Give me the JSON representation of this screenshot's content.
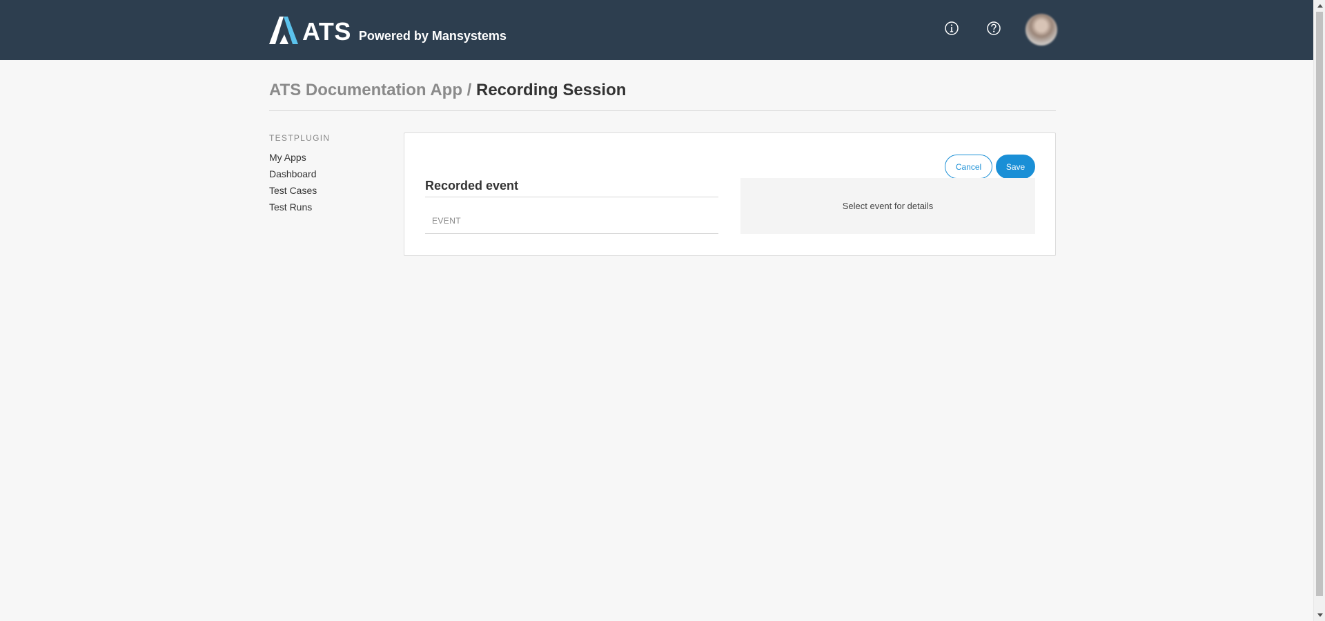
{
  "header": {
    "brand_name": "ATS",
    "brand_tagline": "Powered by Mansystems",
    "info_icon": "info-circle-icon",
    "help_icon": "question-circle-icon",
    "colors": {
      "bar": "#2d3e4f",
      "accent": "#1a8fd6",
      "logo_light": "#5bc2ec"
    }
  },
  "title": {
    "app": "ATS Documentation App",
    "separator": "/",
    "page": "Recording Session"
  },
  "sidebar": {
    "heading": "TESTPLUGIN",
    "items": [
      {
        "label": "My Apps"
      },
      {
        "label": "Dashboard"
      },
      {
        "label": "Test Cases"
      },
      {
        "label": "Test Runs"
      }
    ]
  },
  "card": {
    "cancel_label": "Cancel",
    "save_label": "Save",
    "section_title": "Recorded event",
    "column_header": "EVENT",
    "details_placeholder": "Select event for details"
  }
}
